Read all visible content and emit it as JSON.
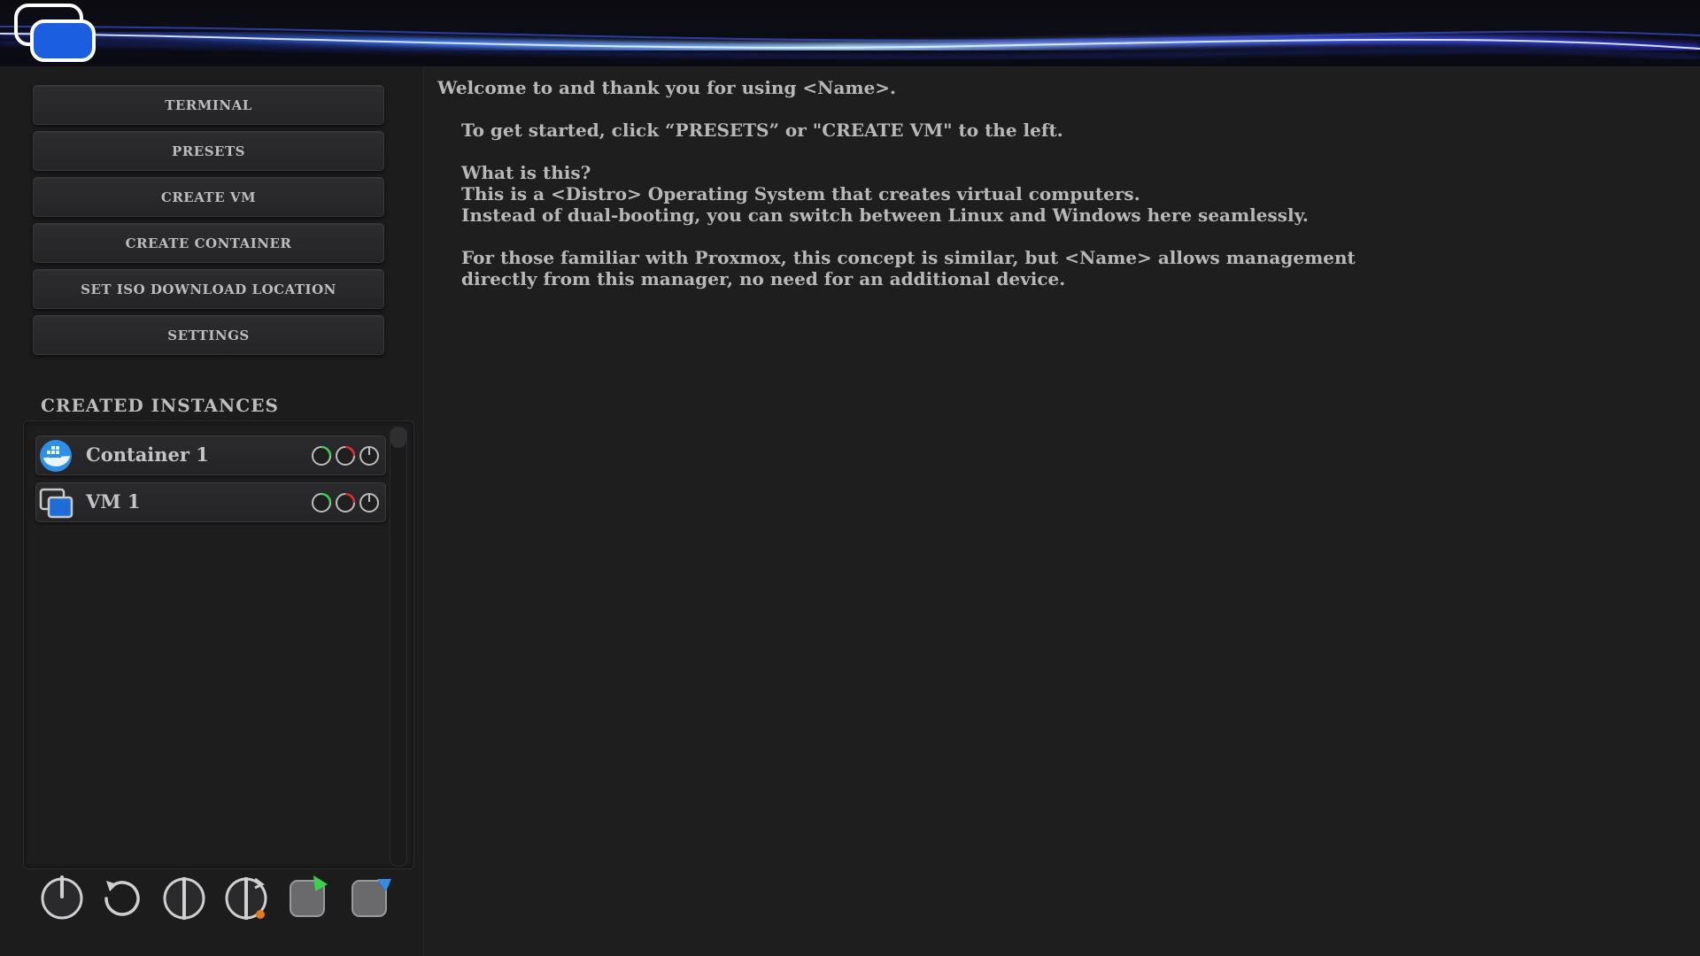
{
  "header": {
    "logo": "stacked-windows-logo",
    "accent_color": "#3a8dff"
  },
  "sidebar": {
    "menu": [
      {
        "label": "TERMINAL"
      },
      {
        "label": "PRESETS"
      },
      {
        "label": "CREATE VM"
      },
      {
        "label": "CREATE CONTAINER"
      },
      {
        "label": "SET ISO DOWNLOAD LOCATION"
      },
      {
        "label": "SETTINGS"
      }
    ],
    "instances_title": "CREATED INSTANCES",
    "instances": [
      {
        "name": "Container 1",
        "icon": "docker-whale-icon"
      },
      {
        "name": "VM 1",
        "icon": "vm-window-icon"
      }
    ],
    "bottom_actions": [
      "power-icon",
      "restart-icon",
      "shutdown-icon",
      "reboot-alert-icon",
      "export-icon",
      "import-icon"
    ]
  },
  "main": {
    "welcome": "Welcome to and thank you for using <Name>.",
    "get_started": "To get started, click “PRESETS” or \"CREATE VM\" to the left.",
    "what_heading": "What is this?",
    "what_line1": "This is a <Distro> Operating System that creates virtual computers.",
    "what_line2": "Instead of dual-booting, you can switch between Linux and Windows here seamlessly.",
    "proxmox_line1": "For those familiar with Proxmox, this concept is similar, but <Name> allows management",
    "proxmox_line2": "directly from this manager, no need for an additional device."
  }
}
